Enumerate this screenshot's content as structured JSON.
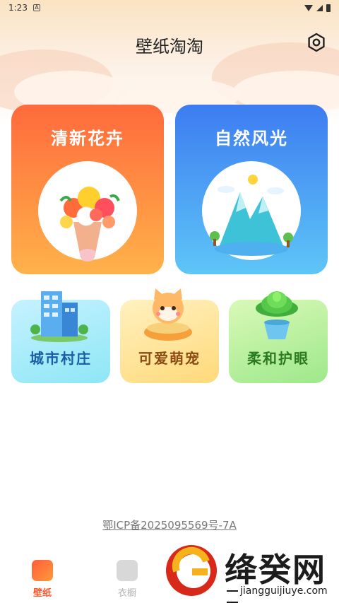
{
  "status_bar": {
    "time": "1:23",
    "notification_letter": "A"
  },
  "header": {
    "title": "壁纸淘淘"
  },
  "categories_big": [
    {
      "label": "清新花卉",
      "color_top": "#ff6a3c",
      "color_bottom": "#ffb24a"
    },
    {
      "label": "自然风光",
      "color_top": "#3d7cf1",
      "color_bottom": "#5ec6f7"
    }
  ],
  "categories_small": [
    {
      "label": "城市村庄"
    },
    {
      "label": "可爱萌宠"
    },
    {
      "label": "柔和护眼"
    }
  ],
  "footer": {
    "icp": "鄂ICP备2025095569号-7A"
  },
  "tabbar": {
    "items": [
      {
        "label": "壁纸",
        "active": true
      },
      {
        "label": "衣橱",
        "active": false
      }
    ]
  },
  "watermark": {
    "brand": "绛癸网",
    "url": "jiangguijiuye.com"
  },
  "colors": {
    "accent": "#ff5a2e",
    "inactive": "#b0b0b0"
  }
}
